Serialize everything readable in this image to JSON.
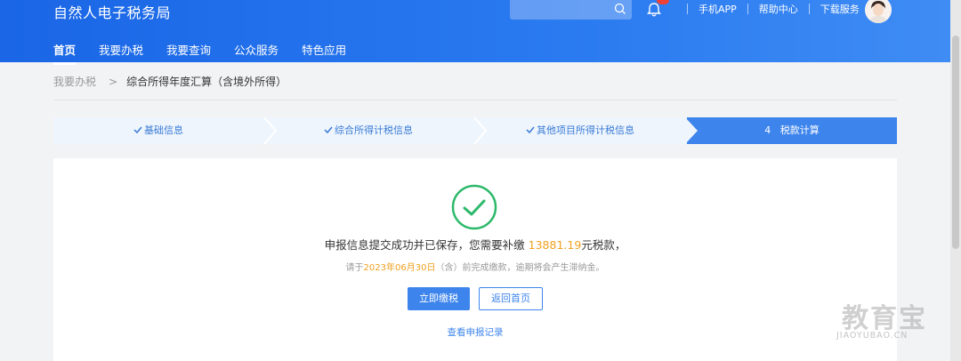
{
  "header": {
    "title": "自然人电子税务局",
    "links": [
      "手机APP",
      "帮助中心",
      "下载服务"
    ],
    "nav": [
      "首页",
      "我要办税",
      "我要查询",
      "公众服务",
      "特色应用"
    ]
  },
  "breadcrumb": {
    "parent": "我要办税",
    "separator": ">",
    "current": "综合所得年度汇算（含境外所得）"
  },
  "steps": [
    {
      "label": "基础信息",
      "done": true
    },
    {
      "label": "综合所得计税信息",
      "done": true
    },
    {
      "label": "其他项目所得计税信息",
      "done": true
    },
    {
      "number": "4",
      "label": "税款计算",
      "active": true
    }
  ],
  "result": {
    "line1_prefix": "申报信息提交成功并已保存，您需要补缴",
    "amount": "13881.19",
    "line1_suffix": "元税款，",
    "line2_prefix": "请于",
    "deadline": "2023年06月30日",
    "line2_suffix": "（含）前完成缴款，逾期将会产生滞纳金。"
  },
  "buttons": {
    "pay": "立即缴税",
    "home": "返回首页",
    "records": "查看申报记录"
  },
  "watermark": {
    "main": "教育宝",
    "sub": "JIAOYUBAO.CN"
  },
  "colors": {
    "primary": "#3d84ec",
    "header": "#1a66e6",
    "accent_amount": "#f0a020",
    "success": "#2db86a"
  }
}
